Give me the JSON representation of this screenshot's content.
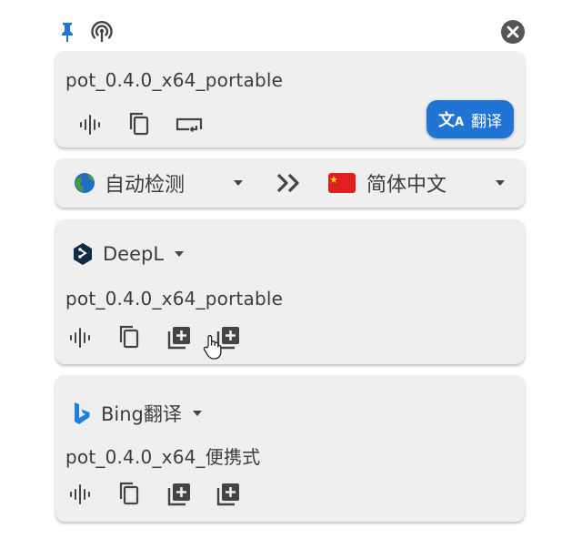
{
  "toolbar": {
    "pin_icon": "pin-icon",
    "listen_icon": "broadcast-icon",
    "close_icon": "close-icon"
  },
  "source": {
    "text": "pot_0.4.0_x64_portable",
    "translate_label": "翻译"
  },
  "languages": {
    "from": "自动检测",
    "to": "简体中文"
  },
  "results": [
    {
      "service": "DeepL",
      "text": "pot_0.4.0_x64_portable"
    },
    {
      "service": "Bing翻译",
      "text": "pot_0.4.0_x64_便携式"
    }
  ],
  "colors": {
    "accent": "#1f74d4",
    "card": "#efefef",
    "pin": "#1f74d4"
  }
}
